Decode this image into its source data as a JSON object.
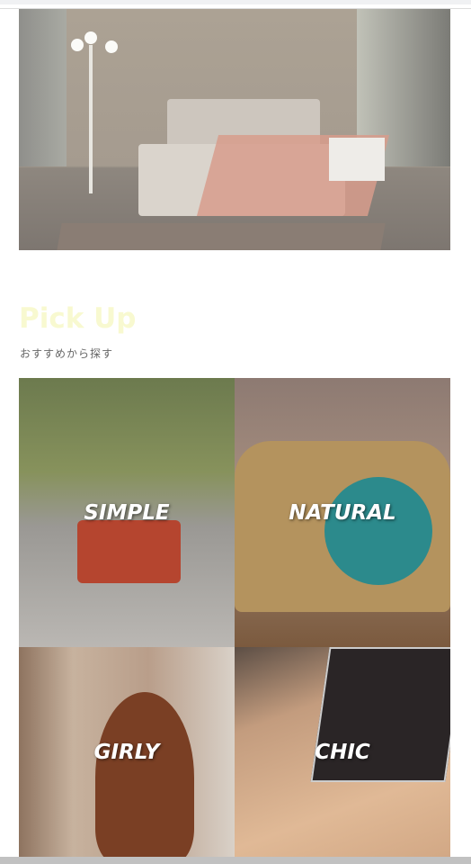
{
  "pickup": {
    "title": "Pick Up",
    "subtitle": "おすすめから探す",
    "title_color": "#f8f9d0",
    "categories": [
      {
        "label": "SIMPLE"
      },
      {
        "label": "NATURAL"
      },
      {
        "label": "GIRLY"
      },
      {
        "label": "CHIC"
      }
    ]
  }
}
